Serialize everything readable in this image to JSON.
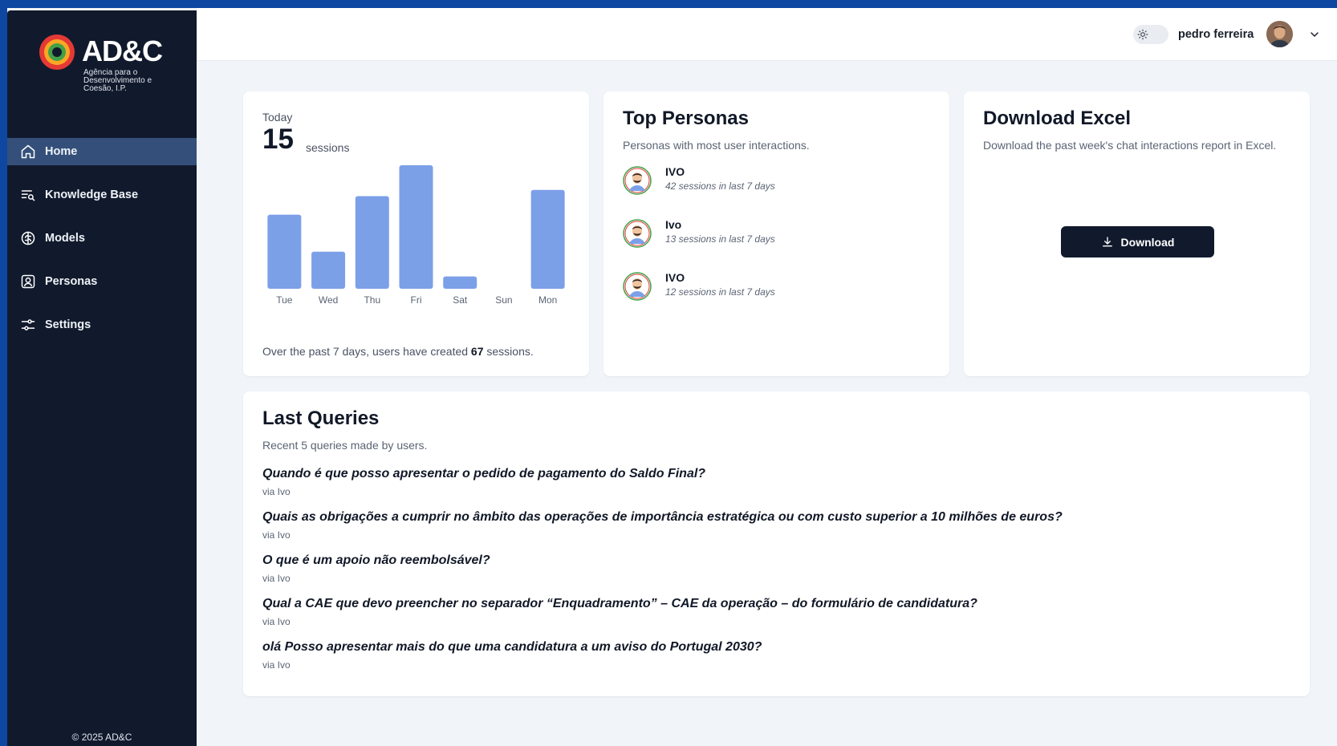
{
  "sidebar": {
    "logo": {
      "name": "AD&C",
      "subtitle": "Agência para o Desenvolvimento e Coesão, I.P."
    },
    "items": [
      {
        "label": "Home",
        "icon": "home-icon",
        "active": true
      },
      {
        "label": "Knowledge Base",
        "icon": "knowledge-base-icon",
        "active": false
      },
      {
        "label": "Models",
        "icon": "brain-icon",
        "active": false
      },
      {
        "label": "Personas",
        "icon": "persona-icon",
        "active": false
      },
      {
        "label": "Settings",
        "icon": "settings-sliders-icon",
        "active": false
      }
    ],
    "footer": "© 2025 AD&C"
  },
  "header": {
    "user_name": "pedro ferreira",
    "theme_icon": "sun-icon"
  },
  "today_card": {
    "label": "Today",
    "value": "15",
    "unit": "sessions",
    "summary_prefix": "Over the past 7 days, users have created",
    "summary_count": "67",
    "summary_suffix": "sessions."
  },
  "chart_data": {
    "type": "bar",
    "categories": [
      "Tue",
      "Wed",
      "Thu",
      "Fri",
      "Sat",
      "Sun",
      "Mon"
    ],
    "values": [
      12,
      6,
      15,
      20,
      2,
      0,
      16
    ],
    "ylim": [
      0,
      20
    ],
    "color": "#7ca0e8",
    "grid": false
  },
  "personas_card": {
    "title": "Top Personas",
    "subtitle": "Personas with most user interactions.",
    "items": [
      {
        "name": "IVO",
        "meta": "42 sessions in last 7 days"
      },
      {
        "name": "Ivo",
        "meta": "13 sessions in last 7 days"
      },
      {
        "name": "IVO",
        "meta": "12 sessions in last 7 days"
      }
    ]
  },
  "download_card": {
    "title": "Download Excel",
    "subtitle": "Download the past week's chat interactions report in Excel.",
    "button_label": "Download"
  },
  "queries_card": {
    "title": "Last Queries",
    "subtitle": "Recent 5 queries made by users.",
    "items": [
      {
        "text": "Quando é que posso apresentar o pedido de pagamento do Saldo Final?",
        "via": "via Ivo"
      },
      {
        "text": "Quais as obrigações a cumprir no âmbito das operações de importância estratégica ou com custo superior a 10 milhões de euros?",
        "via": "via Ivo"
      },
      {
        "text": "O que é um apoio não reembolsável?",
        "via": "via Ivo"
      },
      {
        "text": "Qual a CAE que devo preencher no separador “Enquadramento” – CAE da operação – do formulário de candidatura?",
        "via": "via Ivo"
      },
      {
        "text": "olá Posso apresentar mais do que uma candidatura a um aviso do Portugal 2030?",
        "via": "via Ivo"
      }
    ]
  },
  "colors": {
    "sidebar_bg": "#111a2c",
    "sidebar_active": "#34507a",
    "page_bg": "#f1f4f8",
    "bar": "#7ca0e8",
    "frame": "#0d47a1"
  }
}
